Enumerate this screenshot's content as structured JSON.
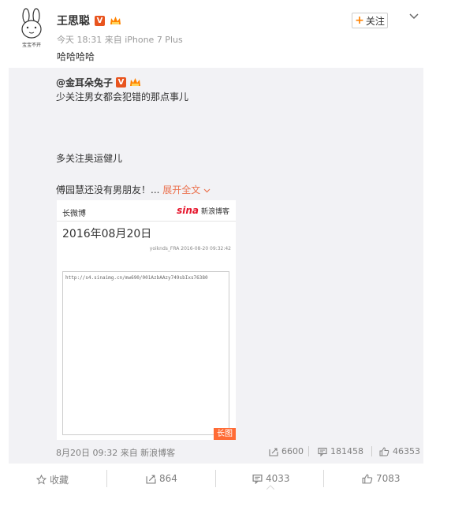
{
  "post": {
    "username": "王思聪",
    "meta": "今天 18:31 来自 iPhone 7 Plus",
    "text": "哈哈哈哈",
    "follow_label": "关注",
    "avatar_caption": "宝宝不开"
  },
  "repost": {
    "username": "@金耳朵兔子",
    "line1": "少关注男女都会犯错的那点事儿",
    "line2": "多关注奥运健儿",
    "line3": "傅园慧还没有男朋友！...",
    "expand_label": "展开全文",
    "card": {
      "title": "长微博",
      "logo_text": "新浪博客",
      "logo_mark": "sina",
      "date": "2016年08月20日",
      "subtitle": "yoiknds_FRA 2016-08-20 09:32:42",
      "url": "http://s4.sinaimg.cn/mw690/001AzbAAzy749sbIxs76380",
      "tag": "长图"
    },
    "footer_time": "8月20日 09:32 来自 新浪博客",
    "stats": {
      "reposts": "6600",
      "comments": "181458",
      "likes": "46353"
    }
  },
  "actions": {
    "favorite": "收藏",
    "repost": "864",
    "comment": "4033",
    "like": "7083"
  },
  "colors": {
    "accent": "#ff8200",
    "badge_v": "#e8541e",
    "expand_link": "#eb7350",
    "repost_bg": "#f2f2f5"
  }
}
